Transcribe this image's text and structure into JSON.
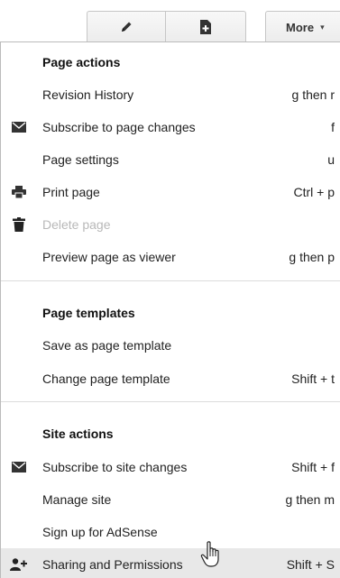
{
  "toolbar": {
    "edit_icon": "pencil-icon",
    "new_page_icon": "new-page-icon",
    "more_label": "More",
    "more_caret": "▾"
  },
  "menu": {
    "page_actions": {
      "heading": "Page actions",
      "items": [
        {
          "label": "Revision History",
          "shortcut": "g then r",
          "icon": ""
        },
        {
          "label": "Subscribe to page changes",
          "shortcut": "f",
          "icon": "envelope-icon"
        },
        {
          "label": "Page settings",
          "shortcut": "u",
          "icon": ""
        },
        {
          "label": "Print page",
          "shortcut": "Ctrl + p",
          "icon": "printer-icon"
        },
        {
          "label": "Delete page",
          "shortcut": "",
          "icon": "trash-icon",
          "disabled": true
        },
        {
          "label": "Preview page as viewer",
          "shortcut": "g then p",
          "icon": ""
        }
      ]
    },
    "page_templates": {
      "heading": "Page templates",
      "items": [
        {
          "label": "Save as page template",
          "shortcut": ""
        },
        {
          "label": "Change page template",
          "shortcut": "Shift + t"
        }
      ]
    },
    "site_actions": {
      "heading": "Site actions",
      "items": [
        {
          "label": "Subscribe to site changes",
          "shortcut": "Shift + f",
          "icon": "envelope-icon"
        },
        {
          "label": "Manage site",
          "shortcut": "g then m",
          "icon": ""
        },
        {
          "label": "Sign up for AdSense",
          "shortcut": "",
          "icon": ""
        },
        {
          "label": "Sharing and Permissions",
          "shortcut": "Shift + S",
          "icon": "add-person-icon",
          "hovered": true
        }
      ]
    }
  }
}
